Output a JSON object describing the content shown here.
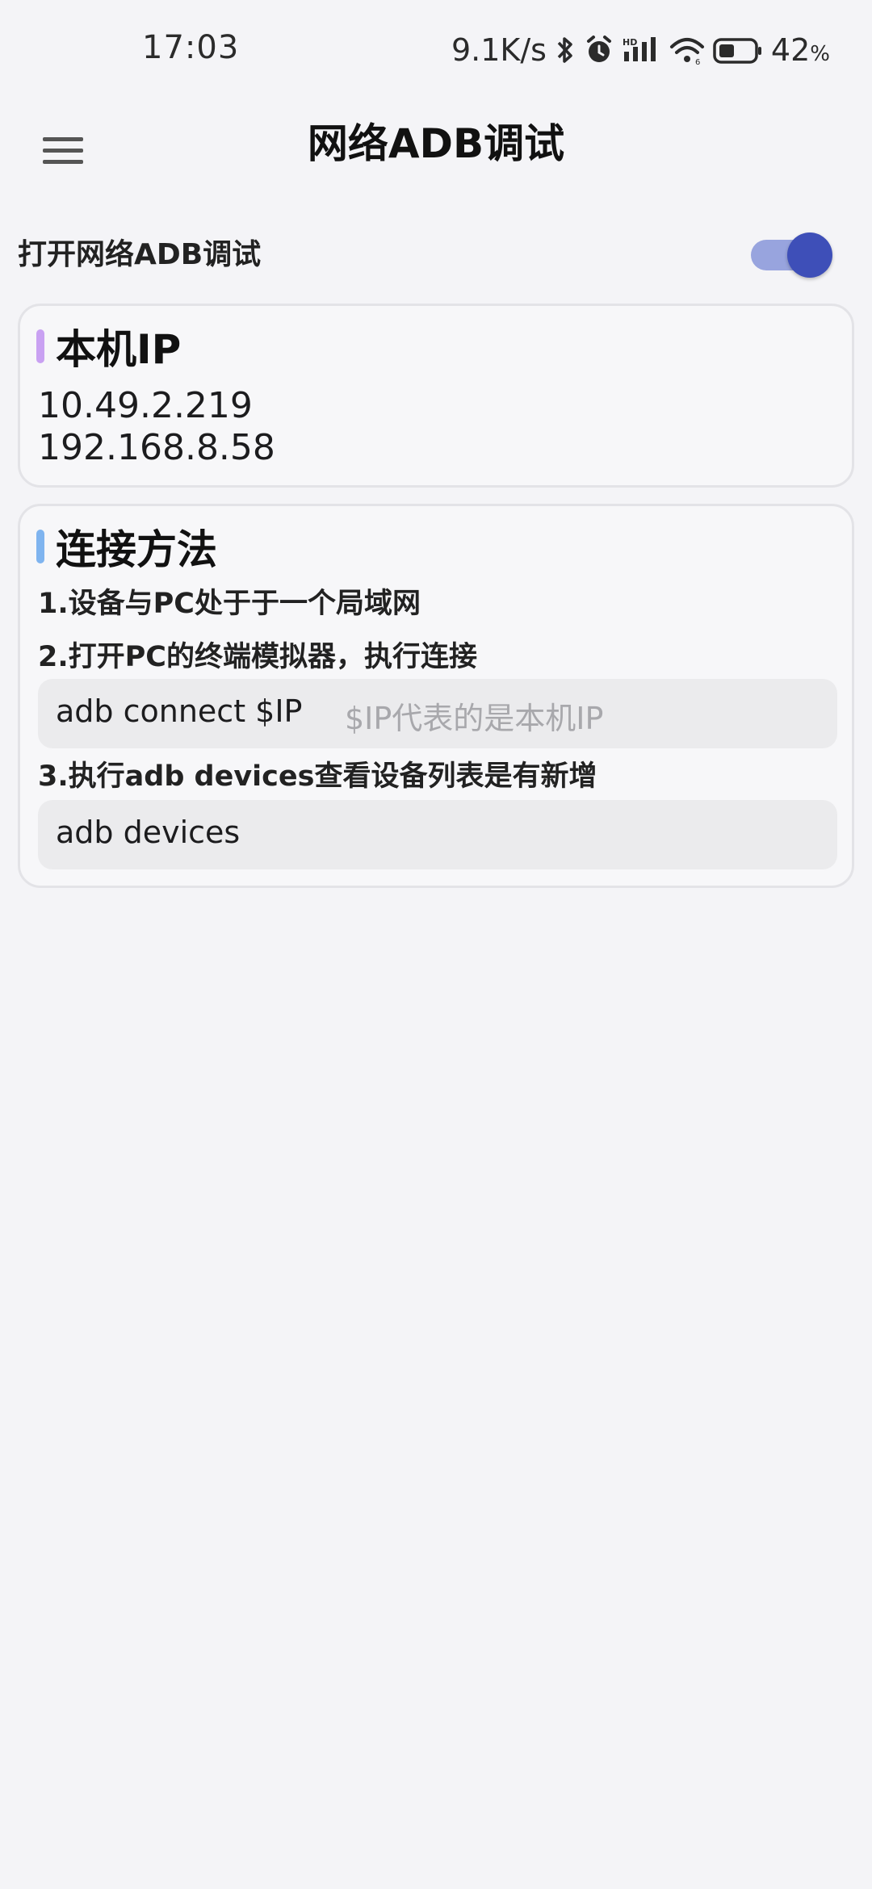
{
  "status_bar": {
    "time": "17:03",
    "net_speed": "9.1K/s",
    "battery": "42",
    "battery_unit": "%"
  },
  "app_bar": {
    "title": "网络ADB调试",
    "menu_icon": "hamburger-menu-icon"
  },
  "toggle": {
    "label": "打开网络ADB调试",
    "on": true,
    "track_color": "#98a4de",
    "thumb_color": "#3e4fb8"
  },
  "ip_card": {
    "title": "本机IP",
    "accent_color": "#c9a1f2",
    "ips": [
      "10.49.2.219",
      "192.168.8.58"
    ]
  },
  "connect_card": {
    "title": "连接方法",
    "accent_color": "#7fb4ef",
    "step1": "1.设备与PC处于于一个局域网",
    "step2": "2.打开PC的终端模拟器，执行连接",
    "cmd1": "adb connect $IP",
    "cmd1_hint": "$IP代表的是本机IP",
    "step3": "3.执行adb devices查看设备列表是有新增",
    "cmd2": "adb devices"
  }
}
